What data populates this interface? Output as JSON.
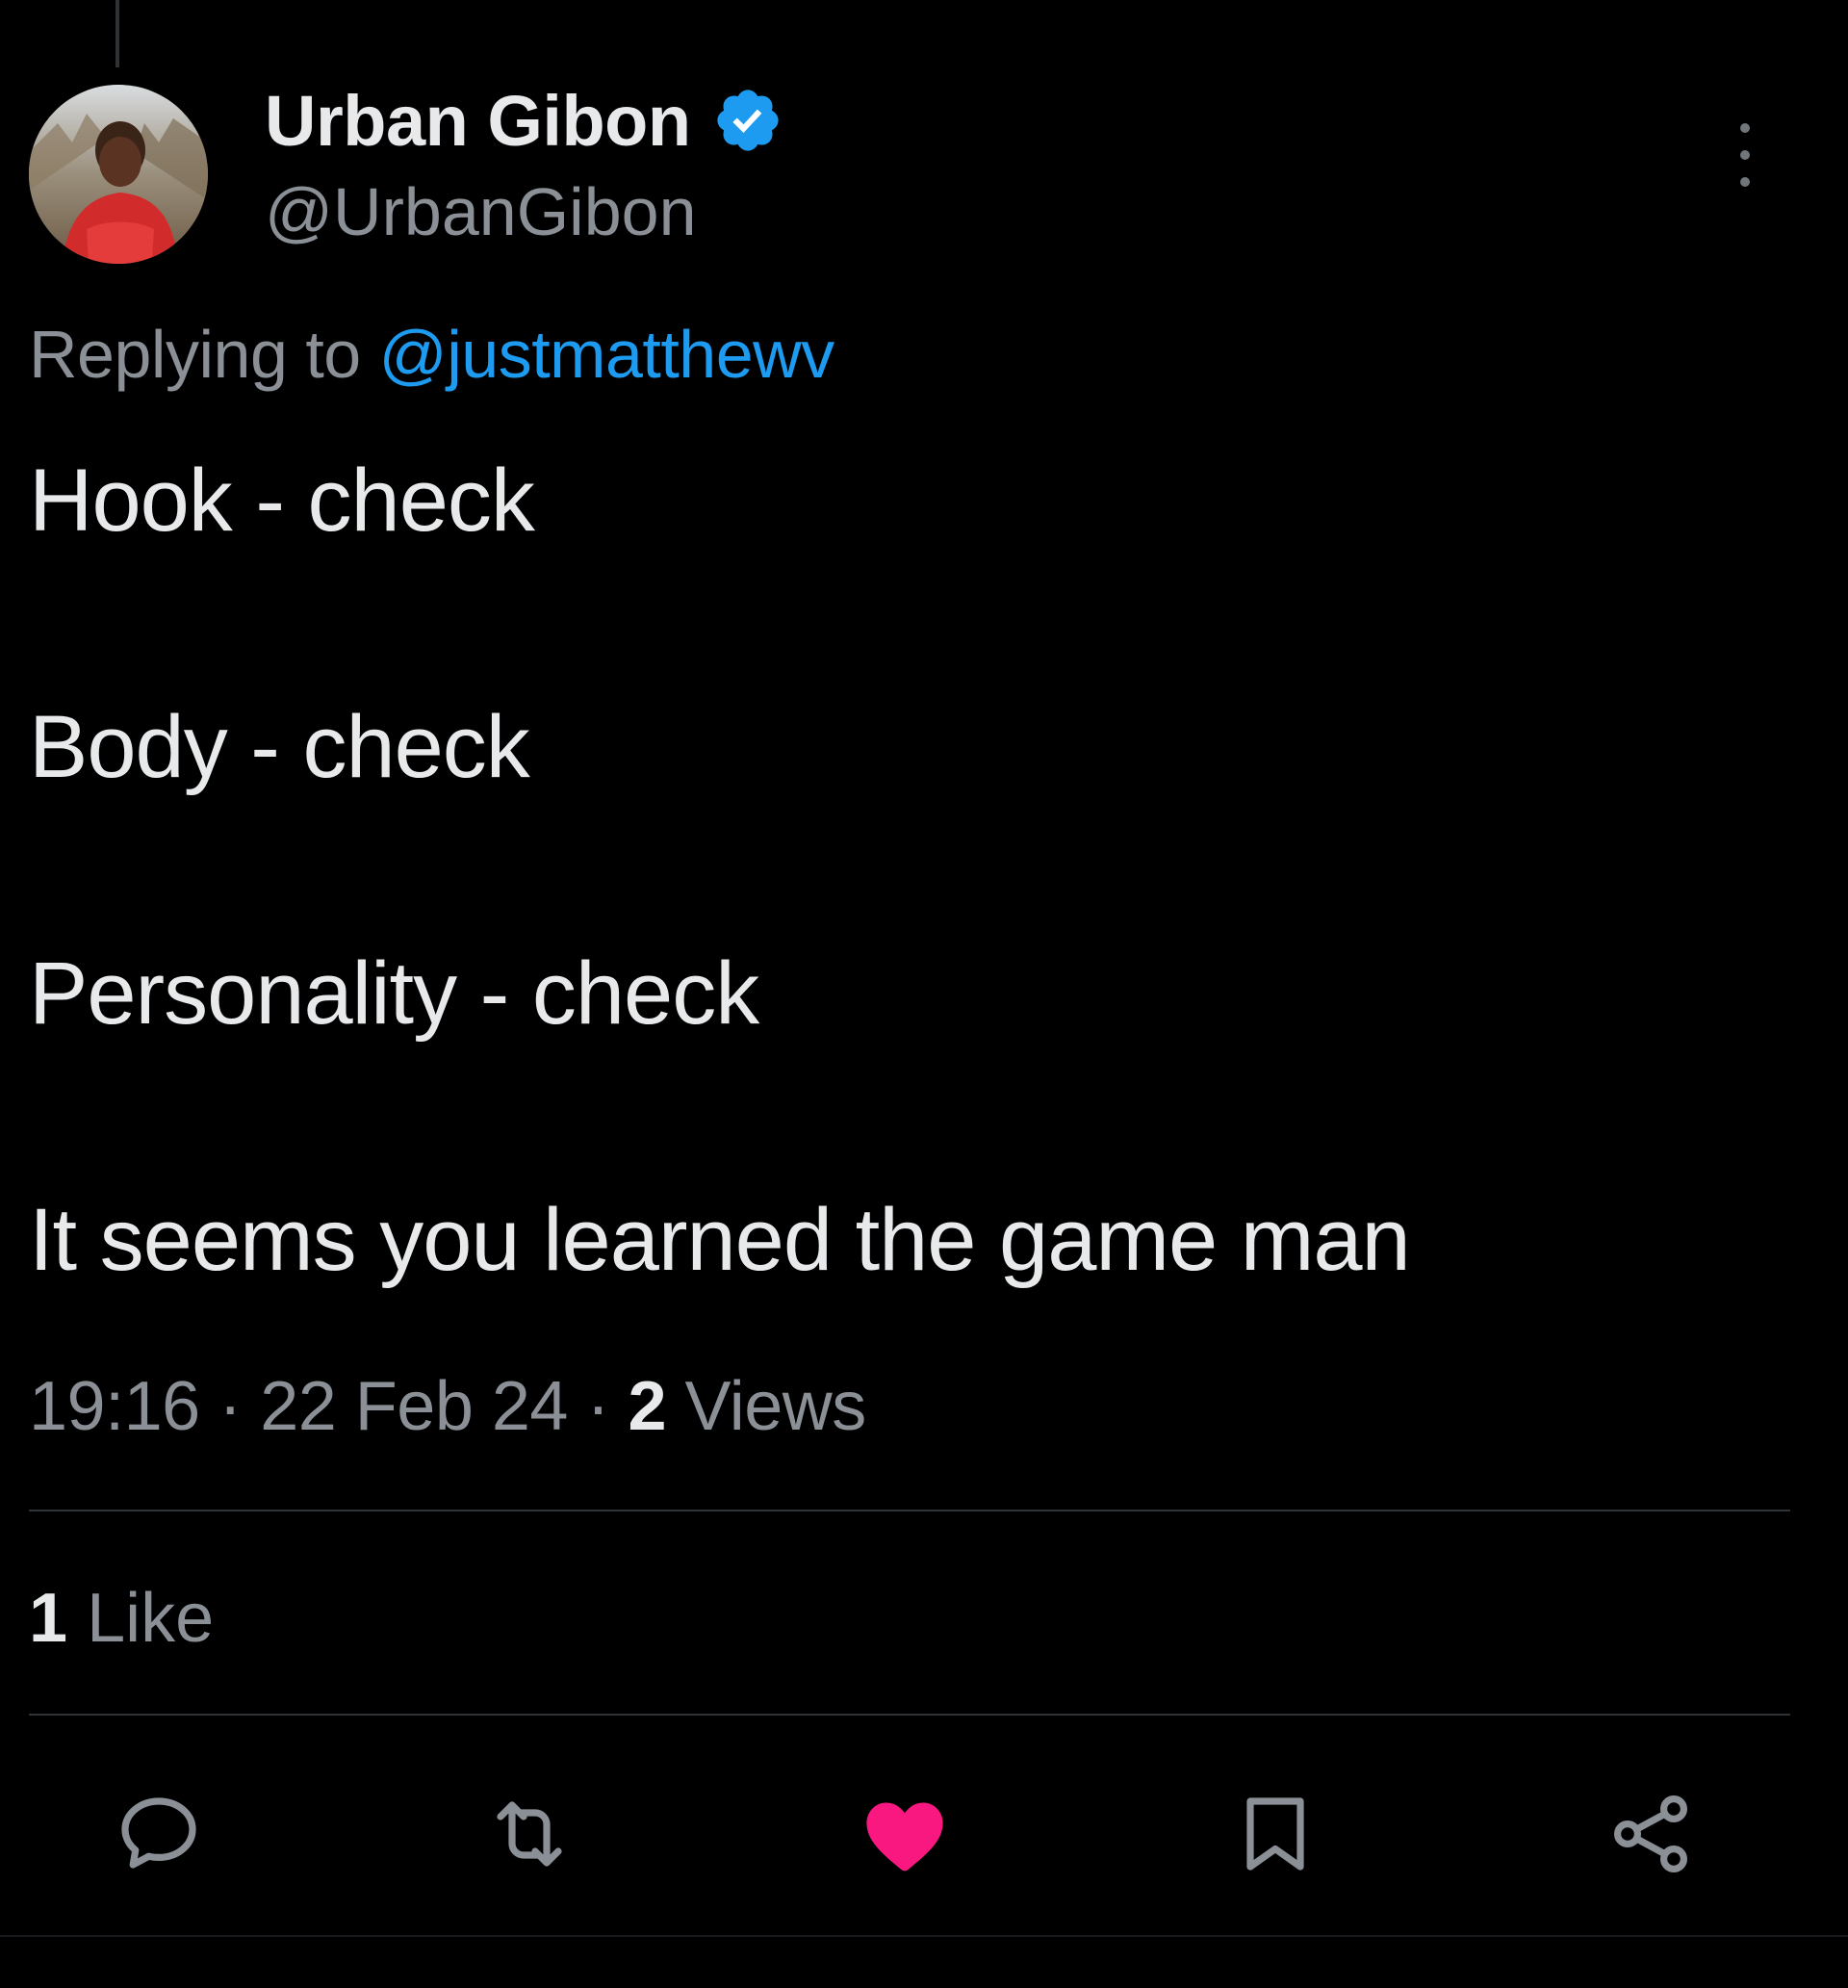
{
  "tweet": {
    "author": {
      "display_name": "Urban Gibon",
      "handle": "@UrbanGibon",
      "verified_icon": "verified-badge-icon"
    },
    "replying_prefix": "Replying to",
    "replying_to": "@justmatthewv",
    "lines": [
      "Hook - check",
      "Body - check",
      "Personality - check",
      "It seems you learned the game man"
    ],
    "meta": {
      "time": "19:16",
      "date": "22 Feb 24",
      "separator": "·",
      "views_count": "2",
      "views_label": "Views"
    },
    "likes": {
      "count": "1",
      "label": "Like"
    }
  },
  "actions": [
    {
      "name": "reply-icon"
    },
    {
      "name": "retweet-icon"
    },
    {
      "name": "like-icon",
      "active": true
    },
    {
      "name": "bookmark-icon"
    },
    {
      "name": "share-icon"
    }
  ],
  "colors": {
    "background": "#000000",
    "text": "#e7e9ea",
    "secondary": "#8b9096",
    "link": "#1d9bf0",
    "like_active": "#f91880"
  }
}
